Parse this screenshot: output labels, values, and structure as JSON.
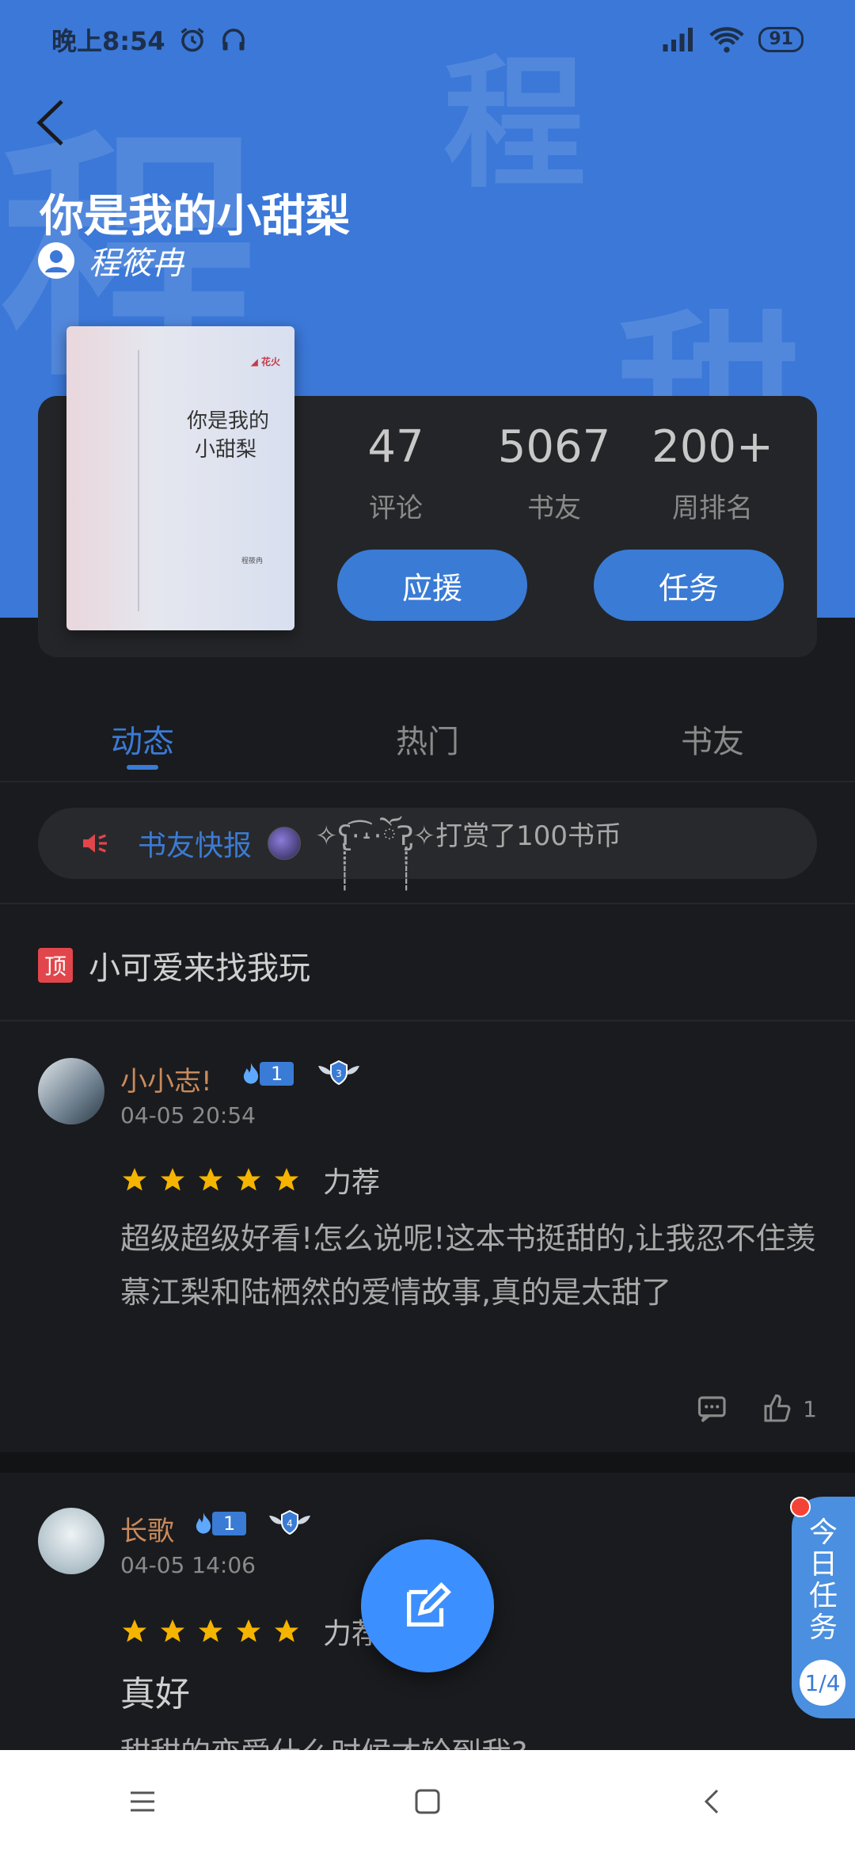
{
  "status_bar": {
    "time": "晚上8:54",
    "battery": "91"
  },
  "book": {
    "title": "你是我的小甜梨",
    "author": "程筱冉",
    "cover_title_line1": "你是我的",
    "cover_title_line2": "小甜梨"
  },
  "stats": [
    {
      "value": "47",
      "label": "评论"
    },
    {
      "value": "5067",
      "label": "书友"
    },
    {
      "value": "200+",
      "label": "周排名"
    }
  ],
  "buttons": {
    "support": "应援",
    "task": "任务"
  },
  "tabs": [
    "动态",
    "热门",
    "书友"
  ],
  "news": {
    "label": "书友快报",
    "text": "✧ʕ̢̣̣̣̣̩̩̩̩·͡˔·ོɁ̡̣̣̣̣̩̩̩̩✧打赏了100书币"
  },
  "pinned": {
    "badge": "顶",
    "text": "小可爱来找我玩"
  },
  "posts": [
    {
      "name": "小小志!",
      "level": "1",
      "badge": "3",
      "date": "04-05 20:54",
      "rating_label": "力荐",
      "content": "超级超级好看!怎么说呢!这本书挺甜的,让我忍不住羡慕江梨和陆栖然的爱情故事,真的是太甜了",
      "likes": "1"
    },
    {
      "name": "长歌",
      "level": "1",
      "badge": "4",
      "date": "04-05 14:06",
      "rating_label": "力荐",
      "content_title": "真好",
      "content": "甜甜的恋爱什么时候才轮到我?"
    }
  ],
  "task_widget": {
    "label": "今日任务",
    "progress": "1/4"
  },
  "colors": {
    "accent": "#3a7bd5",
    "hero": "#3b78d8",
    "background": "#1a1b1e"
  }
}
